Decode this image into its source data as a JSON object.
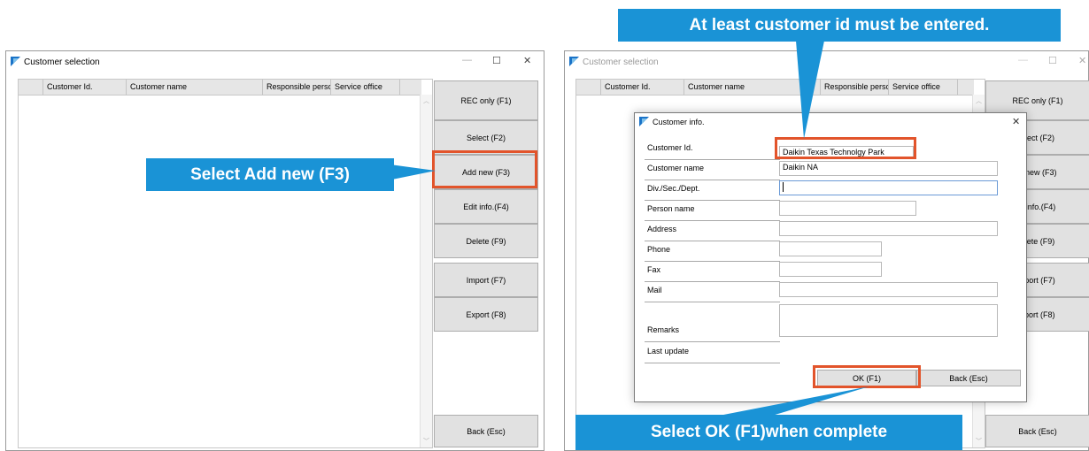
{
  "left_window": {
    "title": "Customer selection",
    "columns": [
      "Customer Id.",
      "Customer name",
      "Responsible persc",
      "Service office"
    ],
    "buttons": {
      "rec_only": "REC only (F1)",
      "select": "Select (F2)",
      "add_new": "Add new (F3)",
      "edit_info": "Edit info.(F4)",
      "delete": "Delete (F9)",
      "import": "Import (F7)",
      "export": "Export (F8)",
      "back": "Back (Esc)"
    }
  },
  "right_window": {
    "title": "Customer selection",
    "columns": [
      "Customer Id.",
      "Customer name",
      "Responsible persc",
      "Service office"
    ],
    "buttons": {
      "rec_only": "REC only (F1)",
      "select": "elect (F2)",
      "add_new": "d new (F3)",
      "edit_info": "it info.(F4)",
      "delete": "elete (F9)",
      "import": "nport (F7)",
      "export": "xport (F8)",
      "back": "Back (Esc)"
    }
  },
  "dialog": {
    "title": "Customer info.",
    "fields": {
      "customer_id": {
        "label": "Customer Id.",
        "value": "Daikin Texas Technolgy Park"
      },
      "customer_name": {
        "label": "Customer name",
        "value": "Daikin NA"
      },
      "division": {
        "label": "Div./Sec./Dept.",
        "value": ""
      },
      "person_name": {
        "label": "Person name",
        "value": ""
      },
      "address": {
        "label": "Address",
        "value": ""
      },
      "phone": {
        "label": "Phone",
        "value": ""
      },
      "fax": {
        "label": "Fax",
        "value": ""
      },
      "mail": {
        "label": "Mail",
        "value": ""
      },
      "remarks": {
        "label": "Remarks",
        "value": ""
      },
      "last_update": {
        "label": "Last update",
        "value": ""
      }
    },
    "ok_label": "OK (F1)",
    "back_label": "Back (Esc)"
  },
  "callouts": {
    "add_new": "Select Add new (F3)",
    "customer_id": "At least customer id must be entered.",
    "ok": "Select OK (F1)when complete"
  },
  "colors": {
    "callout": "#1a93d6",
    "highlight": "#e2542b",
    "button": "#e1e1e1"
  }
}
